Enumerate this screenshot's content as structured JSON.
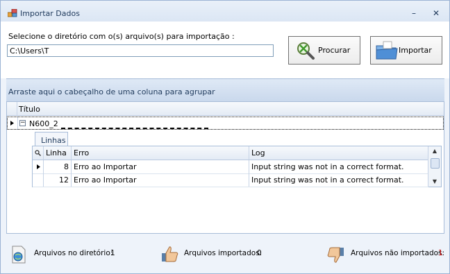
{
  "window": {
    "title": "Importar Dados",
    "minimize_glyph": "–",
    "close_glyph": "✕"
  },
  "form": {
    "directory_label": "Selecione o diretório com o(s) arquivo(s) para importação :",
    "directory_value": "C:\\Users\\T",
    "search_button": "Procurar",
    "import_button": "Importar"
  },
  "grid": {
    "group_panel_text": "Arraste aqui o cabeçalho de uma coluna para agrupar",
    "column_title": "Título",
    "group_row": {
      "expander": "−",
      "label": "N600_2"
    },
    "detail": {
      "tab_label": "Linhas",
      "columns": [
        "Linha",
        "Erro",
        "Log"
      ],
      "rows": [
        {
          "linha": "8",
          "erro": "Erro ao Importar",
          "log": "Input string was not in a correct format."
        },
        {
          "linha": "12",
          "erro": "Erro ao Importar",
          "log": "Input string was not in a correct format."
        }
      ]
    }
  },
  "footer": {
    "files_in_dir_label": "Arquivos no diretório:",
    "files_in_dir_count": "1",
    "imported_label": "Arquivos importados:",
    "imported_count": "0",
    "not_imported_label": "Arquivos não importados:",
    "not_imported_count": "1",
    "not_imported_color": "#c00000"
  },
  "icons": [
    "app-icon",
    "minimize-icon",
    "close-icon",
    "search-magnifier-icon",
    "folder-import-icon",
    "globe-file-icon",
    "thumbs-up-icon",
    "thumbs-down-icon",
    "row-pointer-icon",
    "filter-search-icon",
    "scroll-up-icon",
    "scroll-down-icon"
  ]
}
